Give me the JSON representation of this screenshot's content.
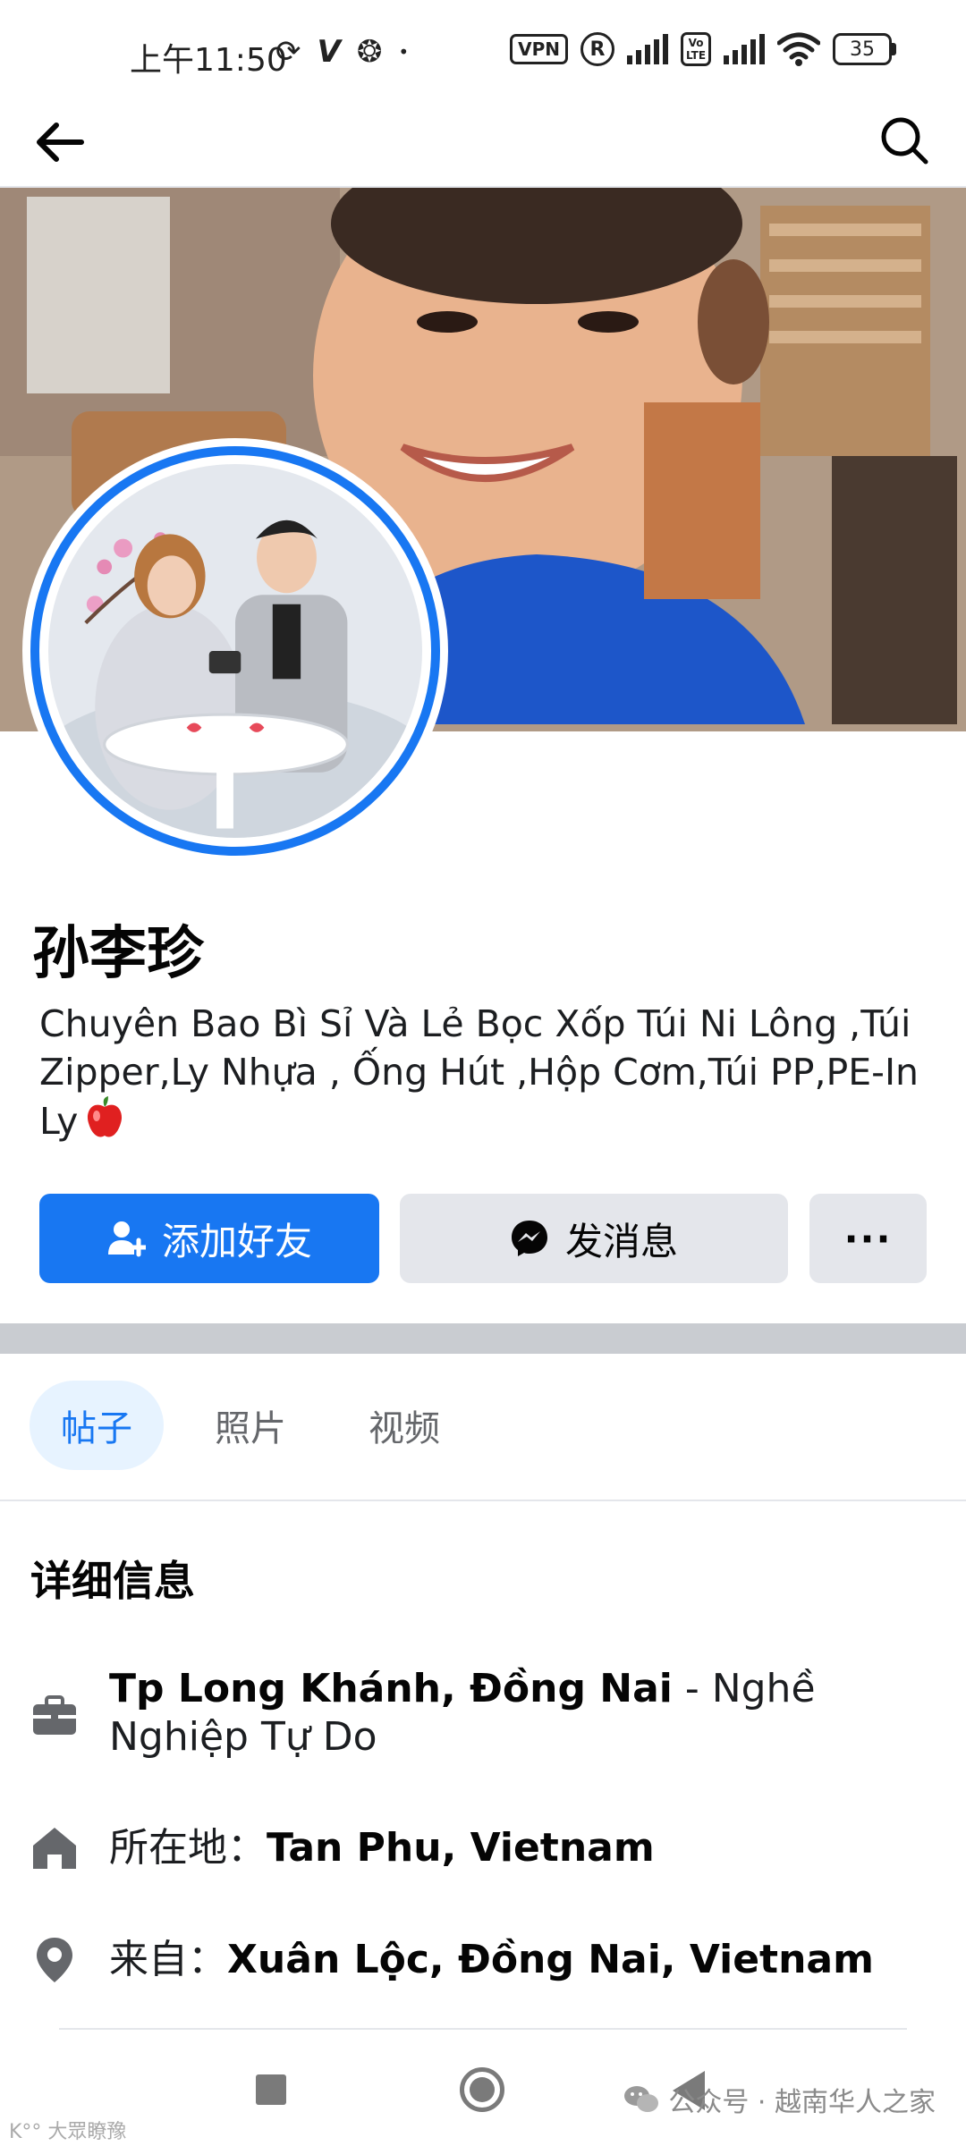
{
  "status_bar": {
    "time": "上午11:50",
    "left_icons": [
      "sync-icon",
      "v-app-icon",
      "aperture-icon",
      "dot-icon"
    ],
    "vpn_label": "VPN",
    "registered_label": "R",
    "volte_label": "Vo LTE",
    "battery_level": "35"
  },
  "nav": {
    "back_icon": "arrow-left-icon",
    "search_icon": "search-icon"
  },
  "profile": {
    "name": "孙李珍",
    "bio": "Chuyên Bao Bì Sỉ Và Lẻ Bọc Xốp Túi Ni Lông ,Túi Zipper,Ly Nhựa , Ống Hút ,Hộp Cơm,Túi PP,PE-In Ly",
    "bio_emoji": "🍎",
    "ring_color": "#1877f2"
  },
  "actions": {
    "add_friend_label": "添加好友",
    "message_label": "发消息",
    "more_label": "···"
  },
  "tabs": [
    {
      "label": "帖子",
      "active": true
    },
    {
      "label": "照片",
      "active": false
    },
    {
      "label": "视频",
      "active": false
    }
  ],
  "details": {
    "title": "详细信息",
    "work": {
      "bold": "Tp Long Khánh, Đồng Nai",
      "rest": " - Nghề Nghiệp Tự Do"
    },
    "home": {
      "prefix": "所在地：",
      "bold": "Tan Phu, Vietnam"
    },
    "from": {
      "prefix": "来自：",
      "bold": "Xuân Lộc, Đồng Nai, Vietnam"
    }
  },
  "watermark": {
    "text": "公众号 · 越南华人之家",
    "left_text": "K°° 大眾瞭豫"
  },
  "colors": {
    "primary": "#1877f2",
    "secondary_button": "#e4e6eb",
    "active_tab_bg": "#e7f3ff",
    "text": "#050505",
    "muted": "#65676b"
  }
}
